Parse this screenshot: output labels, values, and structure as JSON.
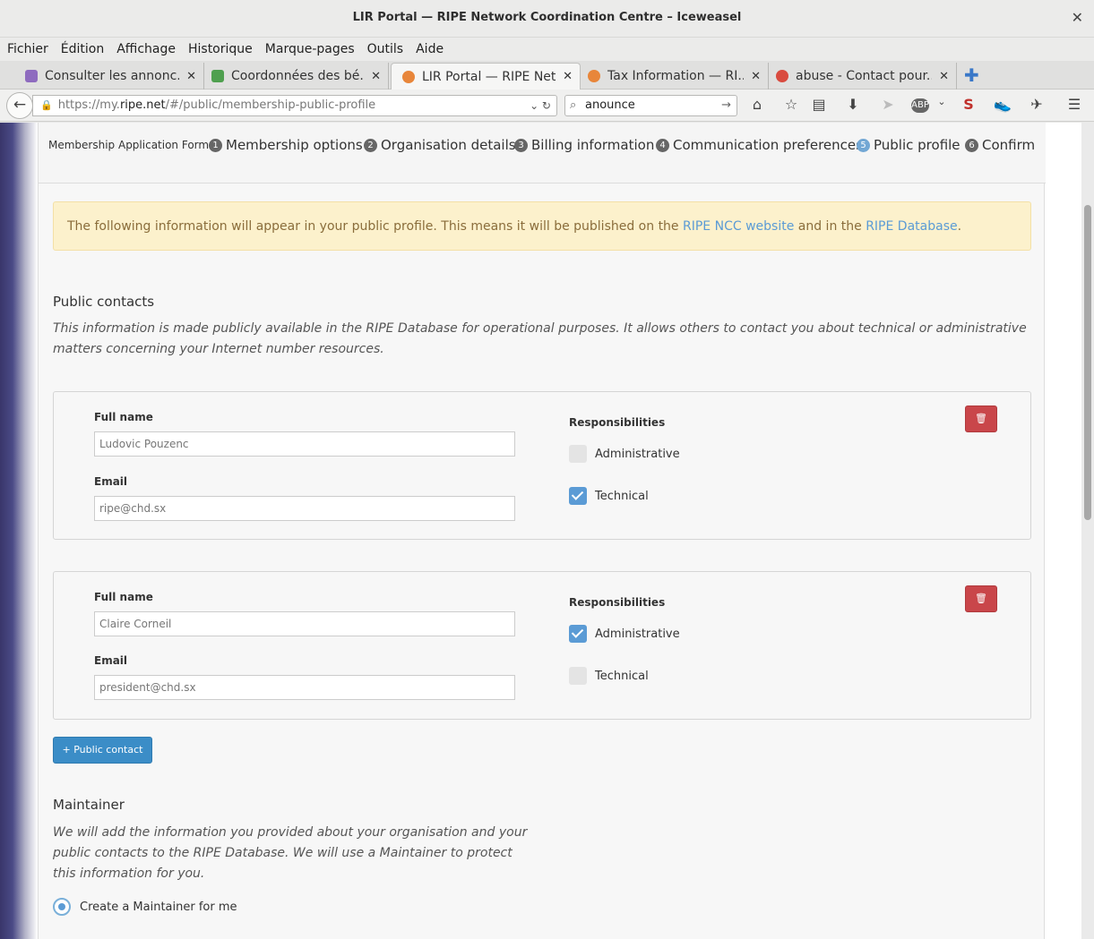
{
  "window": {
    "title": "LIR Portal — RIPE Network Coordination Centre – Iceweasel"
  },
  "menu": [
    "Fichier",
    "Édition",
    "Affichage",
    "Historique",
    "Marque-pages",
    "Outils",
    "Aide"
  ],
  "tabs": [
    {
      "label": "Consulter les annonc...",
      "icon_color": "#8e6bbf"
    },
    {
      "label": "Coordonnées des bé...",
      "icon_color": "#4fa04f"
    },
    {
      "label": "LIR Portal — RIPE Net...",
      "icon_color": "#e8863a",
      "active": true
    },
    {
      "label": "Tax Information — RI...",
      "icon_color": "#e8863a"
    },
    {
      "label": "abuse - Contact pour...",
      "icon_color": "#d94b3f"
    }
  ],
  "nav": {
    "url_prefix": "https://my.",
    "url_domain": "ripe.net",
    "url_suffix": "/#/public/membership-public-profile",
    "search_value": "anounce"
  },
  "steps": {
    "form_title": "Membership Application Form",
    "items": [
      {
        "num": "1",
        "label": "Membership options"
      },
      {
        "num": "2",
        "label": "Organisation details"
      },
      {
        "num": "3",
        "label": "Billing information"
      },
      {
        "num": "4",
        "label": "Communication preferences"
      },
      {
        "num": "5",
        "label": "Public profile",
        "active": true
      },
      {
        "num": "6",
        "label": "Confirm"
      }
    ]
  },
  "alert": {
    "text_before": "The following information will appear in your public profile. This means it will be published on the ",
    "link1": "RIPE NCC website",
    "text_middle": " and in the ",
    "link2": "RIPE Database",
    "text_after": "."
  },
  "public_contacts": {
    "title": "Public contacts",
    "desc_line1": "This information is made publicly available in the RIPE Database for operational purposes. It allows others to contact you about technical or administrative",
    "desc_line2": "matters concerning your Internet number resources.",
    "full_name_label": "Full name",
    "email_label": "Email",
    "responsibilities_label": "Responsibilities",
    "admin_label": "Administrative",
    "tech_label": "Technical",
    "contacts": [
      {
        "full_name": "Ludovic Pouzenc",
        "email": "ripe@chd.sx",
        "administrative": false,
        "technical": true
      },
      {
        "full_name": "Claire Corneil",
        "email": "president@chd.sx",
        "administrative": true,
        "technical": false
      }
    ],
    "add_button": "+ Public contact"
  },
  "maintainer": {
    "title": "Maintainer",
    "desc_line1": "We will add the information you provided about your organisation and your",
    "desc_line2": "public contacts to the RIPE Database. We will use a Maintainer to protect",
    "desc_line3": "this information for you.",
    "option_create": "Create a Maintainer for me"
  }
}
